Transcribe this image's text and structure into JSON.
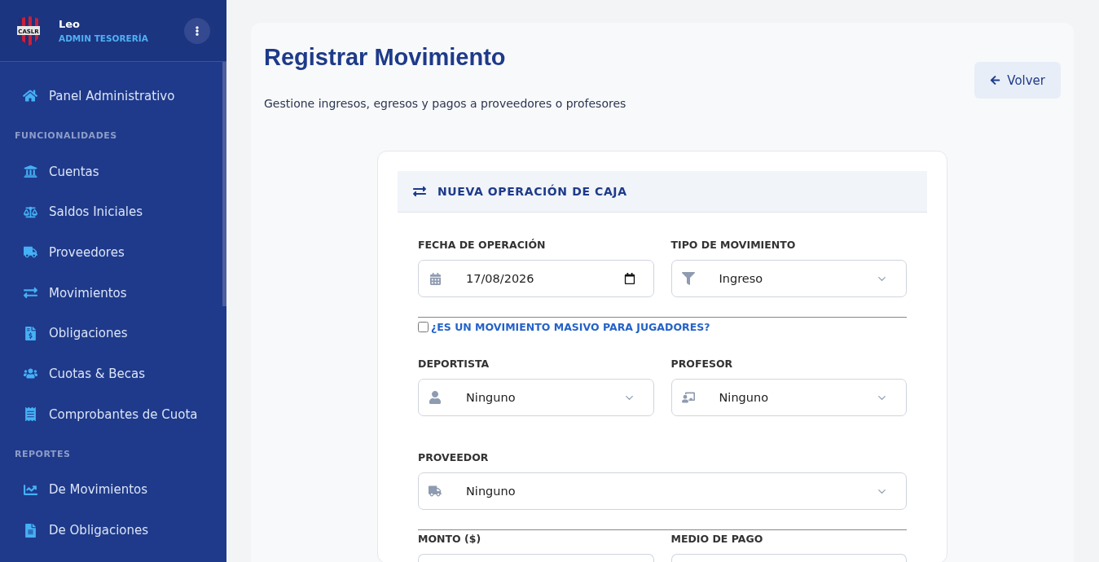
{
  "user": {
    "name": "Leo",
    "role": "ADMIN TESORERÍA",
    "logo_text": "CASLR"
  },
  "sidebar": {
    "top_item": {
      "label": "Panel Administrativo",
      "selected": false
    },
    "sections": [
      {
        "title": "FUNCIONALIDADES",
        "items": [
          {
            "label": "Cuentas",
            "selected": false
          },
          {
            "label": "Saldos Iniciales",
            "selected": false
          },
          {
            "label": "Proveedores",
            "selected": false
          },
          {
            "label": "Movimientos",
            "selected": false
          },
          {
            "label": "Obligaciones",
            "selected": false
          },
          {
            "label": "Cuotas & Becas",
            "selected": false
          },
          {
            "label": "Comprobantes de Cuota",
            "selected": false
          }
        ]
      },
      {
        "title": "REPORTES",
        "items": [
          {
            "label": "De Movimientos",
            "selected": false
          },
          {
            "label": "De Obligaciones",
            "selected": false
          }
        ]
      }
    ]
  },
  "page": {
    "title": "Registrar Movimiento",
    "subtitle": "Gestione ingresos, egresos y pagos a proveedores o profesores",
    "back_button": "Volver"
  },
  "form": {
    "title": "NUEVA OPERACIÓN DE CAJA",
    "row_1": [
      {
        "kind": "date",
        "label": "FECHA DE OPERACIÓN",
        "value": "17/08/2026"
      },
      {
        "kind": "select",
        "label": "TIPO DE MOVIMIENTO",
        "value": "Ingreso"
      }
    ],
    "mass_checkbox": {
      "label": "¿ES UN MOVIMIENTO MASIVO PARA JUGADORES?",
      "checked": false
    },
    "row_2": [
      {
        "kind": "select",
        "label": "DEPORTISTA",
        "value": "Ninguno"
      },
      {
        "kind": "select",
        "label": "PROFESOR",
        "value": "Ninguno"
      }
    ],
    "row_3": [
      {
        "kind": "select",
        "label": "PROVEEDOR",
        "value": "Ninguno"
      }
    ],
    "row_4": [
      {
        "kind": "cut",
        "label": "MONTO ($)"
      },
      {
        "kind": "cut",
        "label": "MEDIO DE PAGO"
      }
    ]
  }
}
